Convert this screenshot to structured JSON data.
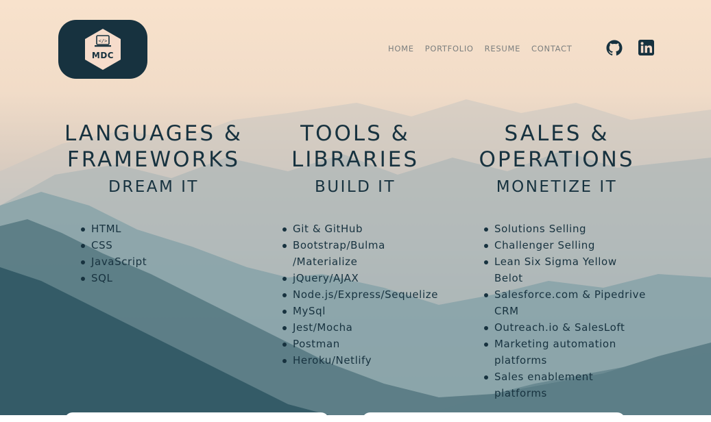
{
  "brand": {
    "logo_text": "MDC",
    "logo_icon": "code-screen-icon"
  },
  "nav": {
    "home": "HOME",
    "portfolio": "PORTFOLIO",
    "resume": "RESUME",
    "contact": "CONTACT"
  },
  "social": {
    "github_icon": "github-icon",
    "linkedin_icon": "linkedin-icon"
  },
  "columns": [
    {
      "title_line1": "LANGUAGES &",
      "title_line2": "FRAMEWORKS",
      "subtitle": "DREAM IT",
      "items": [
        "HTML",
        "CSS",
        "JavaScript",
        "SQL"
      ]
    },
    {
      "title_line1": "TOOLS &",
      "title_line2": "LIBRARIES",
      "subtitle": "BUILD IT",
      "items": [
        "Git & GitHub",
        "Bootstrap/Bulma",
        "/Materialize",
        "jQuery/AJAX",
        "Node.js/Express/Sequelize",
        "MySql",
        "Jest/Mocha",
        "Postman",
        "Heroku/Netlify"
      ]
    },
    {
      "title_line1": "SALES &",
      "title_line2": "OPERATIONS",
      "subtitle": "MONETIZE IT",
      "items": [
        "Solutions Selling",
        "Challenger Selling",
        "Lean Six Sigma Yellow",
        "Belot",
        "Salesforce.com & Pipedrive",
        "CRM",
        "Outreach.io & SalesLoft",
        "Marketing automation",
        "platforms",
        "Sales enablement",
        "platforms"
      ]
    }
  ],
  "colors": {
    "primary": "#17323f",
    "nav_text": "#7c7f7f",
    "sky_top": "#f8e2cc"
  }
}
